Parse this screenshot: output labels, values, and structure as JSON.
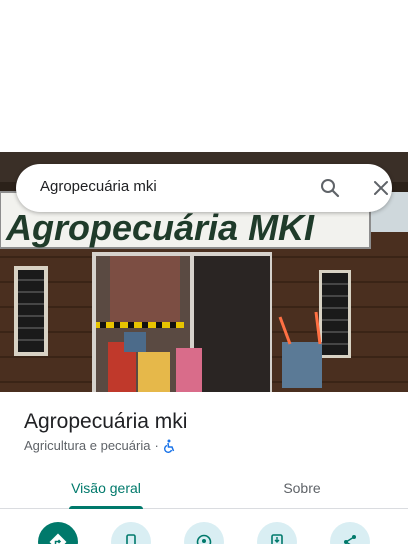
{
  "search": {
    "query": "Agropecuária mki"
  },
  "photo": {
    "sign_text": "Agropecuária MKI"
  },
  "place": {
    "name": "Agropecuária mki",
    "category": "Agricultura e pecuária",
    "separator": "·"
  },
  "tabs": [
    {
      "label": "Visão geral",
      "active": true
    },
    {
      "label": "Sobre",
      "active": false
    }
  ],
  "actions": [
    {
      "icon": "directions-icon"
    },
    {
      "icon": "phone-icon"
    },
    {
      "icon": "location-history-icon"
    },
    {
      "icon": "save-to-phone-icon"
    },
    {
      "icon": "share-icon"
    }
  ],
  "colors": {
    "accent": "#00796b",
    "action_bg": "#d9eef3"
  }
}
